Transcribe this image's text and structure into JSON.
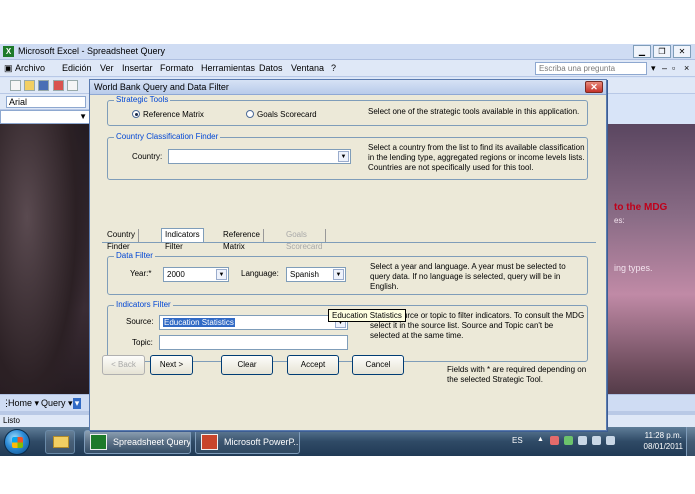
{
  "excel": {
    "window_title": "Microsoft Excel - Spreadsheet Query",
    "menu": [
      "Archivo",
      "Edición",
      "Ver",
      "Insertar",
      "Formato",
      "Herramientas",
      "Datos",
      "Ventana",
      "?"
    ],
    "ask_placeholder": "Escriba una pregunta",
    "font_name": "Arial",
    "mdg_text": "to the MDG",
    "mdg_sub1": "es:",
    "mdg_sub2": "ing types.",
    "bottom_toolbar": {
      "home": "Home",
      "query": "Query"
    },
    "status": "Listo"
  },
  "dialog": {
    "title": "World Bank Query and Data Filter",
    "strategic_tools": {
      "legend": "Strategic Tools",
      "options": [
        {
          "label": "Reference Matrix",
          "selected": true
        },
        {
          "label": "Goals Scorecard",
          "selected": false
        }
      ],
      "help": "Select one of the strategic tools available in this application."
    },
    "country_finder": {
      "legend": "Country Classification Finder",
      "country_label": "Country:",
      "country_value": "",
      "help": "Select a country from the list to find its available classification in the lending type, aggregated regions or income levels lists. Countries are not specifically used for this tool."
    },
    "tabs": [
      {
        "label": "Country Finder",
        "state": "normal"
      },
      {
        "label": "Indicators Filter",
        "state": "active"
      },
      {
        "label": "Reference Matrix",
        "state": "normal"
      },
      {
        "label": "Goals Scorecard",
        "state": "disabled"
      }
    ],
    "data_filter": {
      "legend": "Data Filter",
      "year_label": "Year:*",
      "year_value": "2000",
      "language_label": "Language:",
      "language_value": "Spanish",
      "help": "Select a year and language. A year must be selected to query data. If no language is selected, query will be in English."
    },
    "indicators_filter": {
      "legend": "Indicators Filter",
      "source_label": "Source:",
      "source_value": "Education Statistics",
      "topic_label": "Topic:",
      "topic_value": "",
      "help": "Select source or topic to filter indicators. To consult the MDG select it in the source list. Source and Topic can't be selected at the same time.",
      "tooltip": "Education Statistics"
    },
    "buttons": {
      "back": "< Back",
      "next": "Next >",
      "clear": "Clear",
      "accept": "Accept",
      "cancel": "Cancel"
    },
    "required_note": "Fields with * are required depending on the selected Strategic Tool."
  },
  "taskbar": {
    "tasks": [
      {
        "label": "Spreadsheet Query",
        "app": "excel"
      },
      {
        "label": "Microsoft PowerP...",
        "app": "powerpoint"
      }
    ],
    "language": "ES",
    "time": "11:28 p.m.",
    "date": "08/01/2011"
  }
}
